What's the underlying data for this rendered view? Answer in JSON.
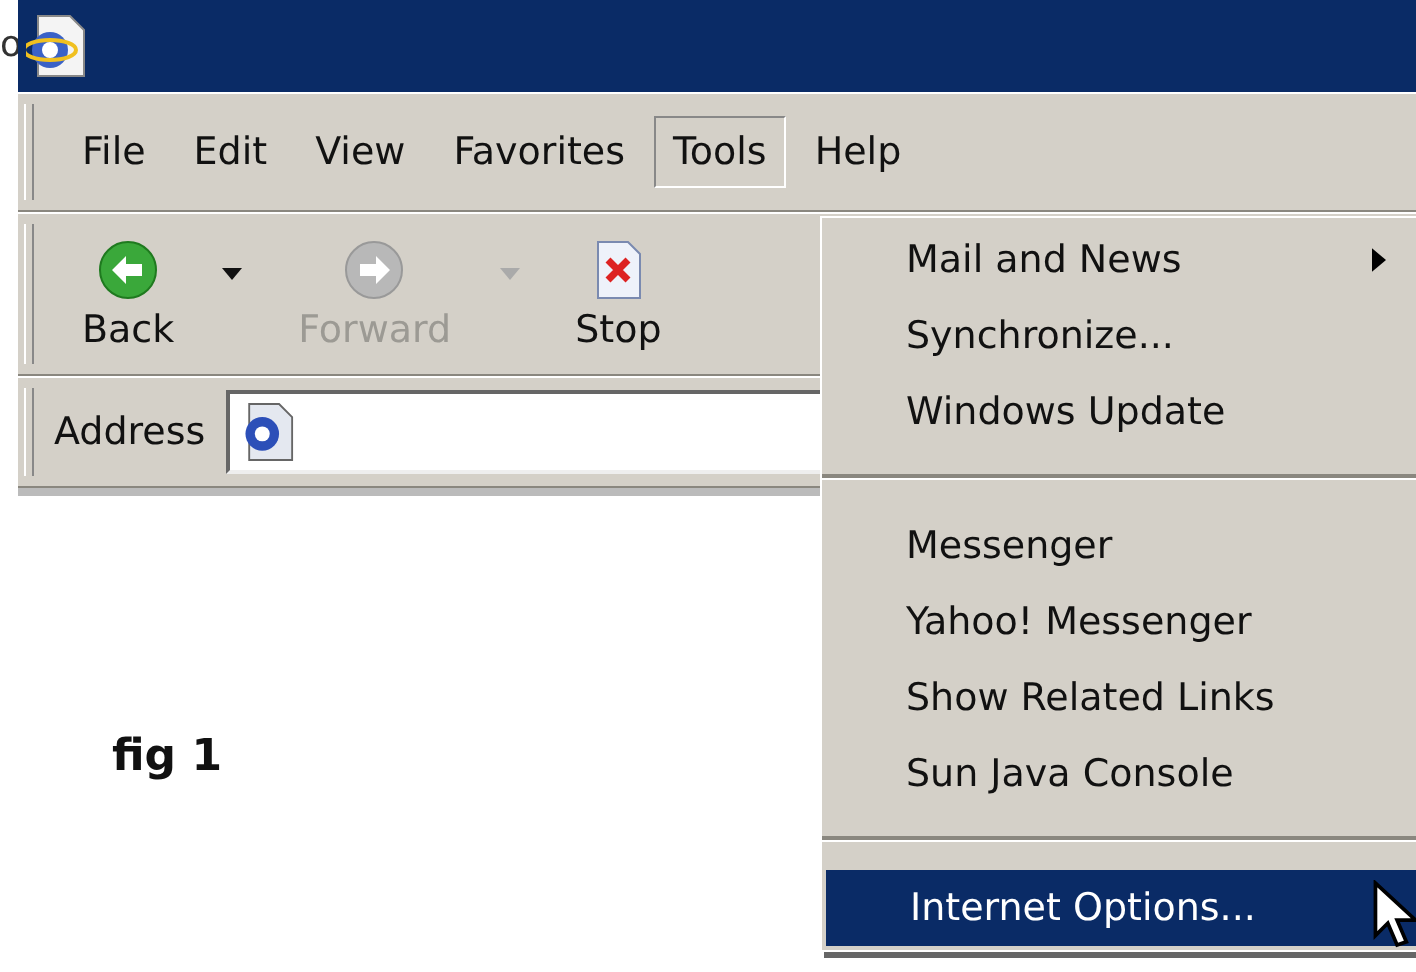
{
  "edge_text": "o",
  "menu_bar": [
    {
      "label": "File",
      "selected": false
    },
    {
      "label": "Edit",
      "selected": false
    },
    {
      "label": "View",
      "selected": false
    },
    {
      "label": "Favorites",
      "selected": false
    },
    {
      "label": "Tools",
      "selected": true
    },
    {
      "label": "Help",
      "selected": false
    }
  ],
  "toolbar": [
    {
      "kind": "back",
      "label": "Back",
      "disabled": false,
      "dropdown": true
    },
    {
      "kind": "forward",
      "label": "Forward",
      "disabled": true,
      "dropdown": true
    },
    {
      "kind": "stop",
      "label": "Stop",
      "disabled": false,
      "dropdown": false
    }
  ],
  "address": {
    "label": "Address"
  },
  "content": {
    "caption": "fig 1"
  },
  "tools_menu": {
    "groups": [
      {
        "items": [
          {
            "label": "Mail and News",
            "submenu": true,
            "selected": false
          },
          {
            "label": "Synchronize...",
            "submenu": false,
            "selected": false
          },
          {
            "label": "Windows Update",
            "submenu": false,
            "selected": false
          }
        ]
      },
      {
        "items": [
          {
            "label": "Messenger",
            "submenu": false,
            "selected": false
          },
          {
            "label": "Yahoo! Messenger",
            "submenu": false,
            "selected": false
          },
          {
            "label": "Show Related Links",
            "submenu": false,
            "selected": false
          },
          {
            "label": "Sun Java Console",
            "submenu": false,
            "selected": false
          }
        ]
      },
      {
        "items": [
          {
            "label": "Internet Options...",
            "submenu": false,
            "selected": true
          }
        ]
      }
    ]
  }
}
